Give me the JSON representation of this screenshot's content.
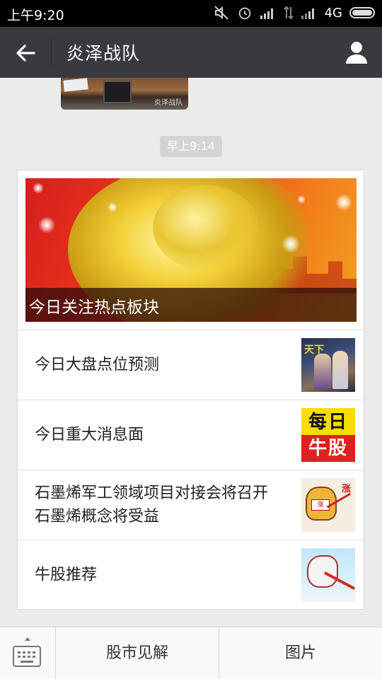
{
  "status_bar": {
    "time": "上午9:20",
    "network": "4G",
    "icons": [
      "mute-icon",
      "alarm-icon",
      "signal-icon",
      "data-transfer-icon",
      "signal-icon",
      "battery-icon"
    ]
  },
  "header": {
    "title": "炎泽战队",
    "back_icon": "back-arrow-icon",
    "profile_icon": "person-icon"
  },
  "previous_message": {
    "watermark": "炎泽战队"
  },
  "timestamp": "早上9:14",
  "article_card": {
    "cover_title": "今日关注热点板块",
    "items": [
      {
        "title": "今日大盘点位预测",
        "thumb_text": "天下"
      },
      {
        "title": "今日重大消息面",
        "thumb_top": "每日",
        "thumb_bottom": "牛股"
      },
      {
        "title": "石墨烯军工领域项目对接会将召开 石墨烯概念将受益",
        "thumb_text": "涨",
        "thumb_tag": "涨"
      },
      {
        "title": "牛股推荐"
      }
    ]
  },
  "bottom_menu": {
    "keyboard_icon": "keyboard-icon",
    "tabs": [
      "股市见解",
      "图片"
    ]
  },
  "colors": {
    "header_bg": "#393a3f",
    "page_bg": "#ebebeb",
    "statusbar_bg": "#000000"
  }
}
